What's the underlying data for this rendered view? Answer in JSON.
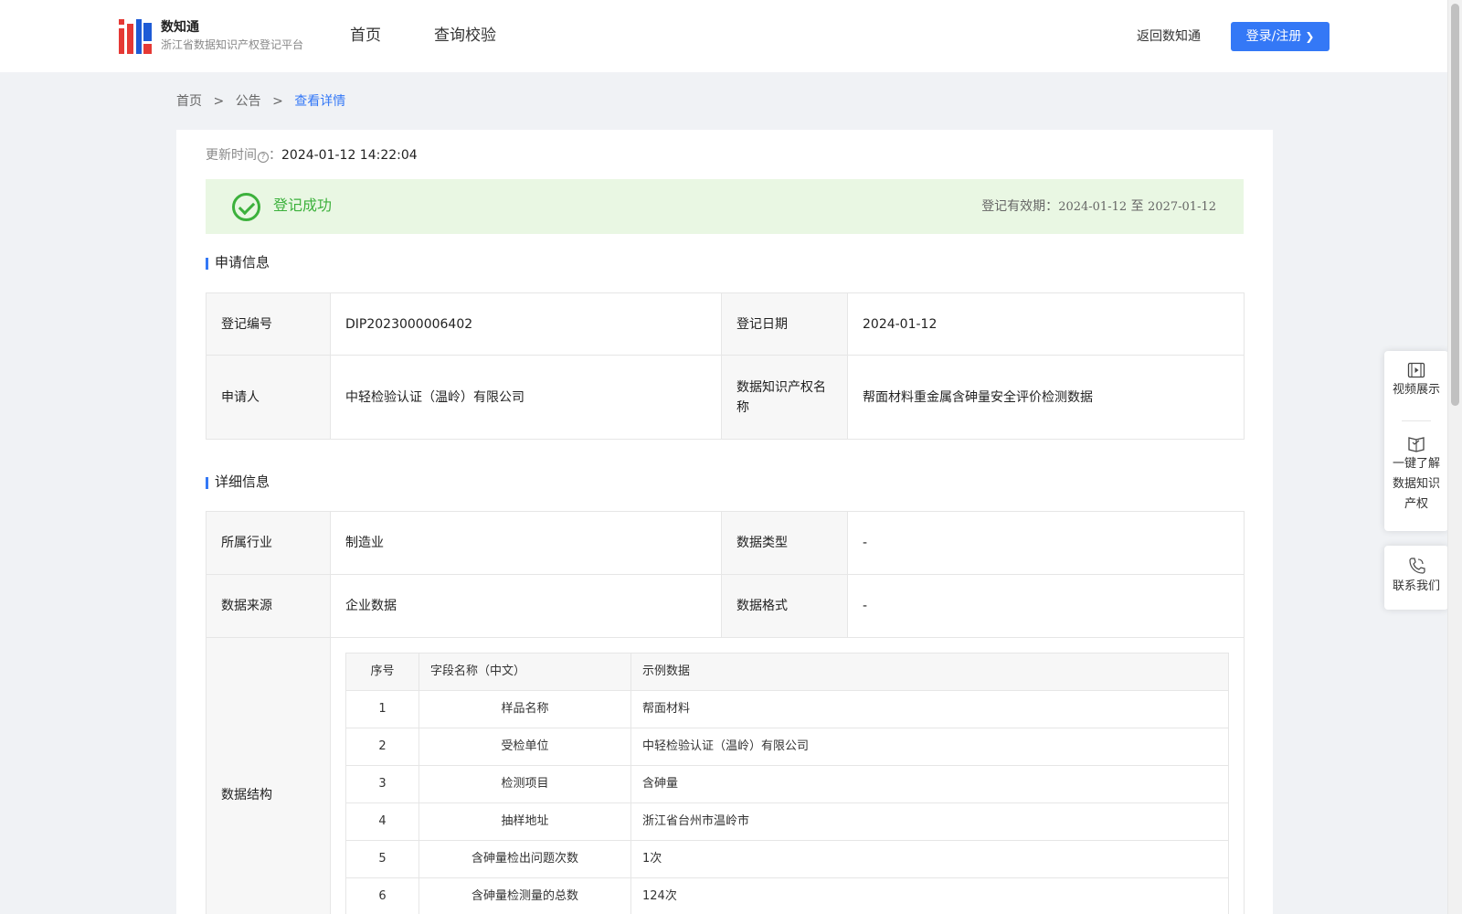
{
  "header": {
    "logo_title": "数知通",
    "logo_subtitle": "浙江省数据知识产权登记平台",
    "nav": [
      "首页",
      "查询校验"
    ],
    "back_link": "返回数知通",
    "login_label": "登录/注册"
  },
  "breadcrumb": {
    "items": [
      "首页",
      "公告",
      "查看详情"
    ],
    "separator": ">"
  },
  "update": {
    "label": "更新时间",
    "help_glyph": "?",
    "colon": "：",
    "value": "2024-01-12 14:22:04"
  },
  "status": {
    "text": "登记成功",
    "validity_label": "登记有效期：",
    "validity_from": "2024-01-12",
    "validity_to_word": "至",
    "validity_to": "2027-01-12",
    "color": "#3cb13c"
  },
  "application": {
    "title": "申请信息",
    "rows": [
      {
        "l1": "登记编号",
        "v1": "DIP2023000006402",
        "l2": "登记日期",
        "v2": "2024-01-12"
      },
      {
        "l1": "申请人",
        "v1": "中轻检验认证（温岭）有限公司",
        "l2": "数据知识产权名称",
        "v2": "帮面材料重金属含砷量安全评价检测数据"
      }
    ]
  },
  "detail": {
    "title": "详细信息",
    "rows": [
      {
        "l1": "所属行业",
        "v1": "制造业",
        "l2": "数据类型",
        "v2": "-"
      },
      {
        "l1": "数据来源",
        "v1": "企业数据",
        "l2": "数据格式",
        "v2": "-"
      }
    ],
    "structure_label": "数据结构",
    "structure": {
      "headers": [
        "序号",
        "字段名称（中文）",
        "示例数据"
      ],
      "rows": [
        [
          "1",
          "样品名称",
          "帮面材料"
        ],
        [
          "2",
          "受检单位",
          "中轻检验认证（温岭）有限公司"
        ],
        [
          "3",
          "检测项目",
          "含砷量"
        ],
        [
          "4",
          "抽样地址",
          "浙江省台州市温岭市"
        ],
        [
          "5",
          "含砷量检出问题次数",
          "1次"
        ],
        [
          "6",
          "含砷量检测量的总数",
          "124次"
        ]
      ]
    }
  },
  "float_panel": {
    "video": "视频展示",
    "learn_lines": [
      "一键了解",
      "数据知识",
      "产权"
    ],
    "contact": "联系我们"
  },
  "colors": {
    "accent": "#3478f6",
    "success_bg": "#e9f7e3",
    "page_bg": "#f0f2f5"
  }
}
